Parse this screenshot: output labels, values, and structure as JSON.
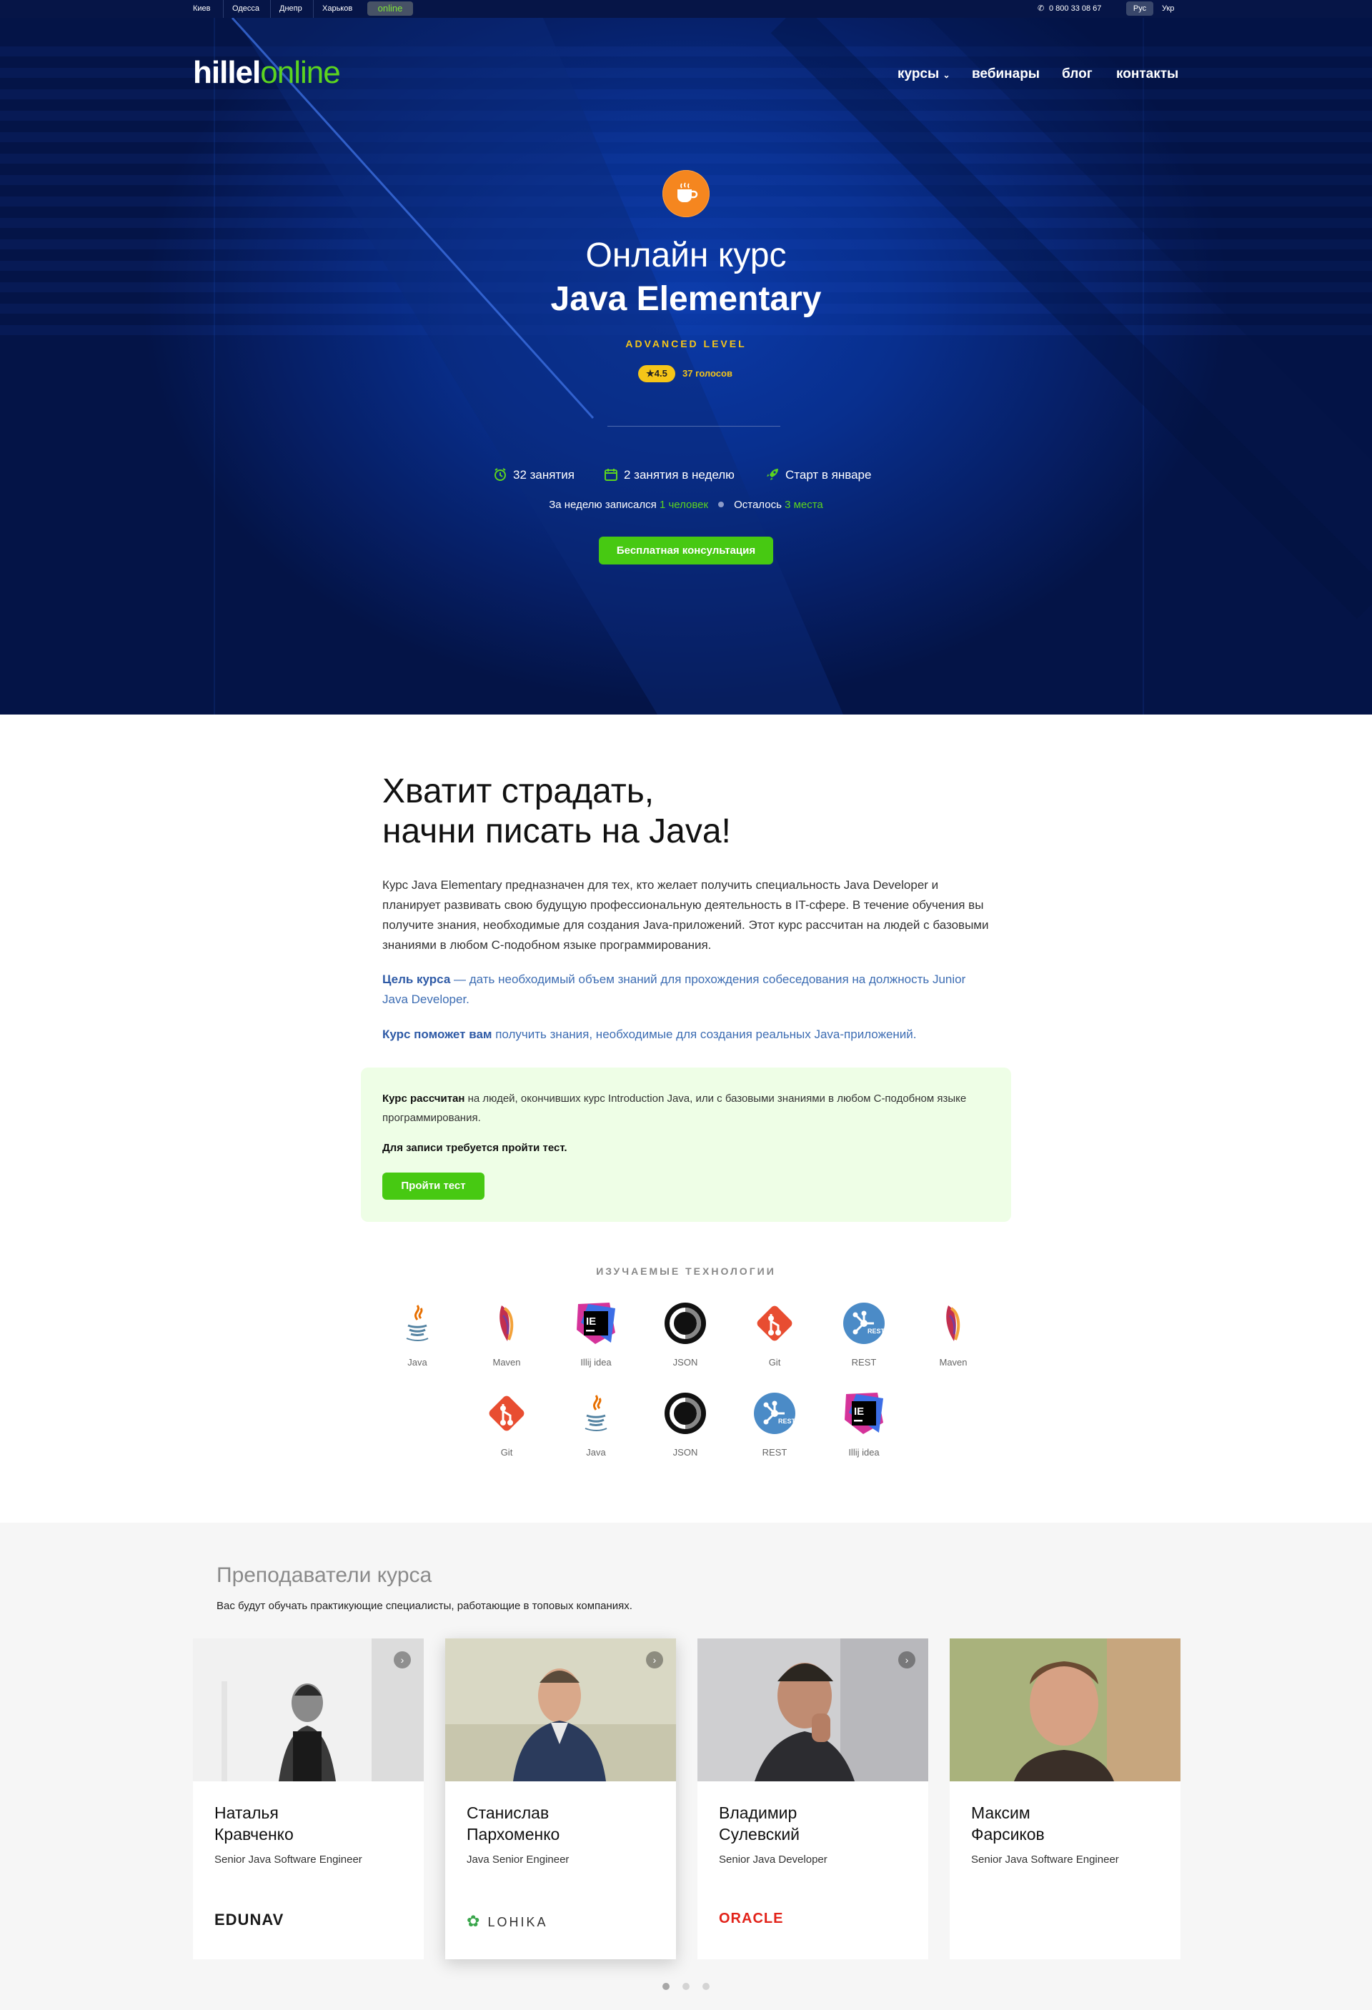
{
  "topbar": {
    "cities": [
      "Киев",
      "Одесса",
      "Днепр",
      "Харьков"
    ],
    "online": "online",
    "phone": "0 800 33 08 67",
    "lang_ru": "Рус",
    "lang_ua": "Укр"
  },
  "header": {
    "logo_hillel": "hillel",
    "logo_online": "online",
    "nav": [
      "курсы",
      "вебинары",
      "блог",
      "контакты"
    ]
  },
  "hero": {
    "title_line1": "Онлайн курс",
    "title_line2": "Java Elementary",
    "level": "ADVANCED LEVEL",
    "rating": "4.5",
    "votes": "37 голосов",
    "stats": [
      "32 занятия",
      "2 занятия в неделю",
      "Старт в январе"
    ],
    "enroll_prefix": "За неделю записался ",
    "enroll_count": "1 человек",
    "remaining_prefix": "Осталось ",
    "remaining_count": "3 места",
    "consult_button": "Бесплатная консультация"
  },
  "intro": {
    "heading_line1": "Хватит страдать,",
    "heading_line2": "начни писать на Java!",
    "p1": "Курс Java Elementary предназначен для тех, кто желает получить специальность Java Developer и планирует развивать свою будущую профессиональную деятельность в IT-сфере. В течение обучения вы получите знания, необходимые для создания Java-приложений. Этот курс рассчитан на людей с базовыми знаниями в любом С-подобном языке программирования.",
    "goal_bold": "Цель курса",
    "goal_text": " — дать необходимый объем знаний для прохождения собеседования на должность Junior Java Developer.",
    "help_bold": "Курс поможет вам",
    "help_text": " получить знания, необходимые для создания реальных Java-приложений."
  },
  "info_box": {
    "bold": "Курс рассчитан",
    "text": " на людей, окончивших курс Introduction Java, или с базовыми знаниями в любом С-подобном языке программирования.",
    "test_note": "Для записи требуется пройти тест.",
    "test_button": "Пройти тест"
  },
  "tech": {
    "title": "ИЗУЧАЕМЫЕ ТЕХНОЛОГИИ",
    "row1": [
      {
        "label": "Java",
        "icon": "java-icon"
      },
      {
        "label": "Maven",
        "icon": "maven-icon"
      },
      {
        "label": "Illij idea",
        "icon": "intellij-icon"
      },
      {
        "label": "JSON",
        "icon": "json-icon"
      },
      {
        "label": "Git",
        "icon": "git-icon"
      },
      {
        "label": "REST",
        "icon": "rest-icon"
      },
      {
        "label": "Maven",
        "icon": "maven-icon"
      }
    ],
    "row2": [
      {
        "label": "Git",
        "icon": "git-icon"
      },
      {
        "label": "Java",
        "icon": "java-icon"
      },
      {
        "label": "JSON",
        "icon": "json-icon"
      },
      {
        "label": "REST",
        "icon": "rest-icon"
      },
      {
        "label": "Illij idea",
        "icon": "intellij-icon"
      }
    ]
  },
  "teachers": {
    "title": "Преподаватели курса",
    "subtitle": "Вас будут обучать практикующие специалисты, работающие в топовых компаниях.",
    "cards": [
      {
        "first": "Наталья",
        "last": "Кравченко",
        "role": "Senior Java Software Engineer",
        "company": "EDUNAV"
      },
      {
        "first": "Станислав",
        "last": "Пархоменко",
        "role": "Java Senior Engineer",
        "company": "LOHIKA"
      },
      {
        "first": "Владимир",
        "last": "Сулевский",
        "role": "Senior Java Developer",
        "company": "ORACLE"
      },
      {
        "first": "Максим",
        "last": "Фарсиков",
        "role": "Senior Java Software Engineer",
        "company": ""
      }
    ]
  },
  "colors": {
    "accent_green": "#47c912",
    "hero_blue": "#082f8e",
    "rating_yellow": "#f5c518",
    "link_blue": "#3d6db3"
  }
}
